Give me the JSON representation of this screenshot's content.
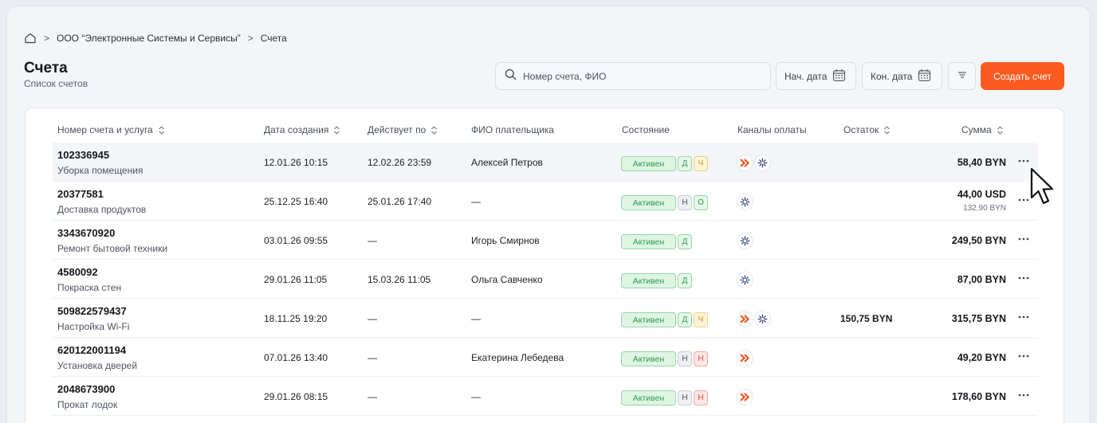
{
  "breadcrumb": {
    "org": "ООО “Электронные Системы и Сервисы”",
    "current": "Счета"
  },
  "page": {
    "title": "Счета",
    "subtitle": "Список счетов"
  },
  "toolbar": {
    "search_placeholder": "Номер счета, ФИО",
    "date_start": "Нач. дата",
    "date_end": "Кон. дата",
    "create_label": "Создать счет"
  },
  "table": {
    "headers": {
      "number": "Номер счета и услуга",
      "created": "Дата создания",
      "valid": "Действует по",
      "payer": "ФИО плательщика",
      "status": "Состояние",
      "channels": "Каналы оплаты",
      "rest": "Остаток",
      "sum": "Сумма"
    },
    "rows": [
      {
        "number": "102336945",
        "service": "Уборка помещения",
        "created": "12.01.26 10:15",
        "valid": "12.02.26 23:59",
        "payer": "Алексей Петров",
        "status": "Активен",
        "chips": [
          "Д",
          "Ч"
        ],
        "channels": [
          "arrow",
          "star"
        ],
        "rest": "",
        "sum": "58,40 BYN",
        "sum2": ""
      },
      {
        "number": "20377581",
        "service": "Доставка продуктов",
        "created": "25.12.25 16:40",
        "valid": "25.01.26 17:40",
        "payer": "—",
        "status": "Активен",
        "chips": [
          "Н",
          "О"
        ],
        "channels": [
          "star"
        ],
        "rest": "",
        "sum": "44,00 USD",
        "sum2": "132,90 BYN"
      },
      {
        "number": "3343670920",
        "service": "Ремонт бытовой техники",
        "created": "03.01.26 09:55",
        "valid": "—",
        "payer": "Игорь Смирнов",
        "status": "Активен",
        "chips": [
          "Д"
        ],
        "channels": [
          "star"
        ],
        "rest": "",
        "sum": "249,50 BYN",
        "sum2": ""
      },
      {
        "number": "4580092",
        "service": "Покраска стен",
        "created": "29.01.26 11:05",
        "valid": "15.03.26 11:05",
        "payer": "Ольга Савченко",
        "status": "Активен",
        "chips": [
          "Д"
        ],
        "channels": [
          "star"
        ],
        "rest": "",
        "sum": "87,00 BYN",
        "sum2": ""
      },
      {
        "number": "509822579437",
        "service": "Настройка Wi-Fi",
        "created": "18.11.25 19:20",
        "valid": "—",
        "payer": "—",
        "status": "Активен",
        "chips": [
          "Д",
          "Ч"
        ],
        "channels": [
          "arrow",
          "star"
        ],
        "rest": "150,75 BYN",
        "sum": "315,75 BYN",
        "sum2": ""
      },
      {
        "number": "620122001194",
        "service": "Установка дверей",
        "created": "07.01.26 13:40",
        "valid": "—",
        "payer": "Екатерина Лебедева",
        "status": "Активен",
        "chips": [
          "Н",
          "Н"
        ],
        "channels": [
          "arrow"
        ],
        "rest": "",
        "sum": "49,20 BYN",
        "sum2": ""
      },
      {
        "number": "2048673900",
        "service": "Прокат лодок",
        "created": "29.01.26 08:15",
        "valid": "—",
        "payer": "—",
        "status": "Активен",
        "chips": [
          "Н",
          "Н"
        ],
        "channels": [
          "arrow"
        ],
        "rest": "",
        "sum": "178,60 BYN",
        "sum2": ""
      }
    ]
  },
  "colors": {
    "accent": "#fc5a1f",
    "active": "#2f9b4c",
    "warn": "#c4931d",
    "danger": "#db4a3f"
  }
}
